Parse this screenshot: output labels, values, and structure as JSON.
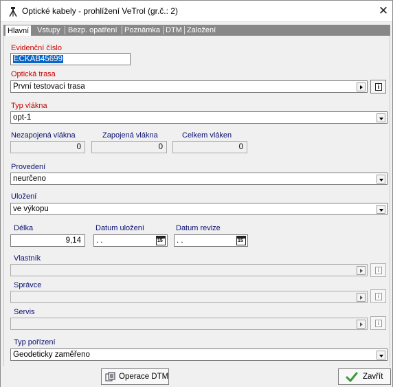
{
  "window": {
    "title": "Optické kabely - prohlížení  VeTrol (gr.č.: 2)",
    "close_glyph": "✕",
    "icon": "tripod-icon"
  },
  "tabs": [
    {
      "label": "Hlavní",
      "active": true
    },
    {
      "label": "Vstupy",
      "active": false
    },
    {
      "label": "Bezp. opatření",
      "active": false
    },
    {
      "label": "Poznámka",
      "active": false
    },
    {
      "label": "DTM",
      "active": false
    },
    {
      "label": "Založení",
      "active": false
    }
  ],
  "form": {
    "evidencni_cislo": {
      "label": "Evidenční číslo",
      "value": "ECKAB45699"
    },
    "opticka_trasa": {
      "label": "Optická trasa",
      "value": "První testovací trasa"
    },
    "typ_vlakna": {
      "label": "Typ vlákna",
      "value": "opt-1"
    },
    "nezapojena": {
      "label": "Nezapojená vlákna",
      "value": "0"
    },
    "zapojena": {
      "label": "Zapojená vlákna",
      "value": "0"
    },
    "celkem": {
      "label": "Celkem vláken",
      "value": "0"
    },
    "provedeni": {
      "label": "Provedení",
      "value": "neurčeno"
    },
    "ulozeni": {
      "label": "Uložení",
      "value": "ve výkopu"
    },
    "delka": {
      "label": "Délka",
      "value": "9,14"
    },
    "datum_ulozeni": {
      "label": "Datum uložení",
      "value": " .  ."
    },
    "datum_revize": {
      "label": "Datum revize",
      "value": " .  ."
    },
    "vlastnik": {
      "label": "Vlastník",
      "value": ""
    },
    "spravce": {
      "label": "Správce",
      "value": ""
    },
    "servis": {
      "label": "Servis",
      "value": ""
    },
    "typ_porizeni": {
      "label": "Typ pořízení",
      "value": "Geodeticky zaměřeno"
    }
  },
  "buttons": {
    "operace_dtm": "Operace DTM",
    "zavrit": "Zavřít"
  },
  "calendar_glyph": "15",
  "info_glyph": "i",
  "colors": {
    "required_label": "#cc0000",
    "optional_label": "#0a1070",
    "selection": "#0a64c8",
    "tab_bar": "#888888"
  }
}
